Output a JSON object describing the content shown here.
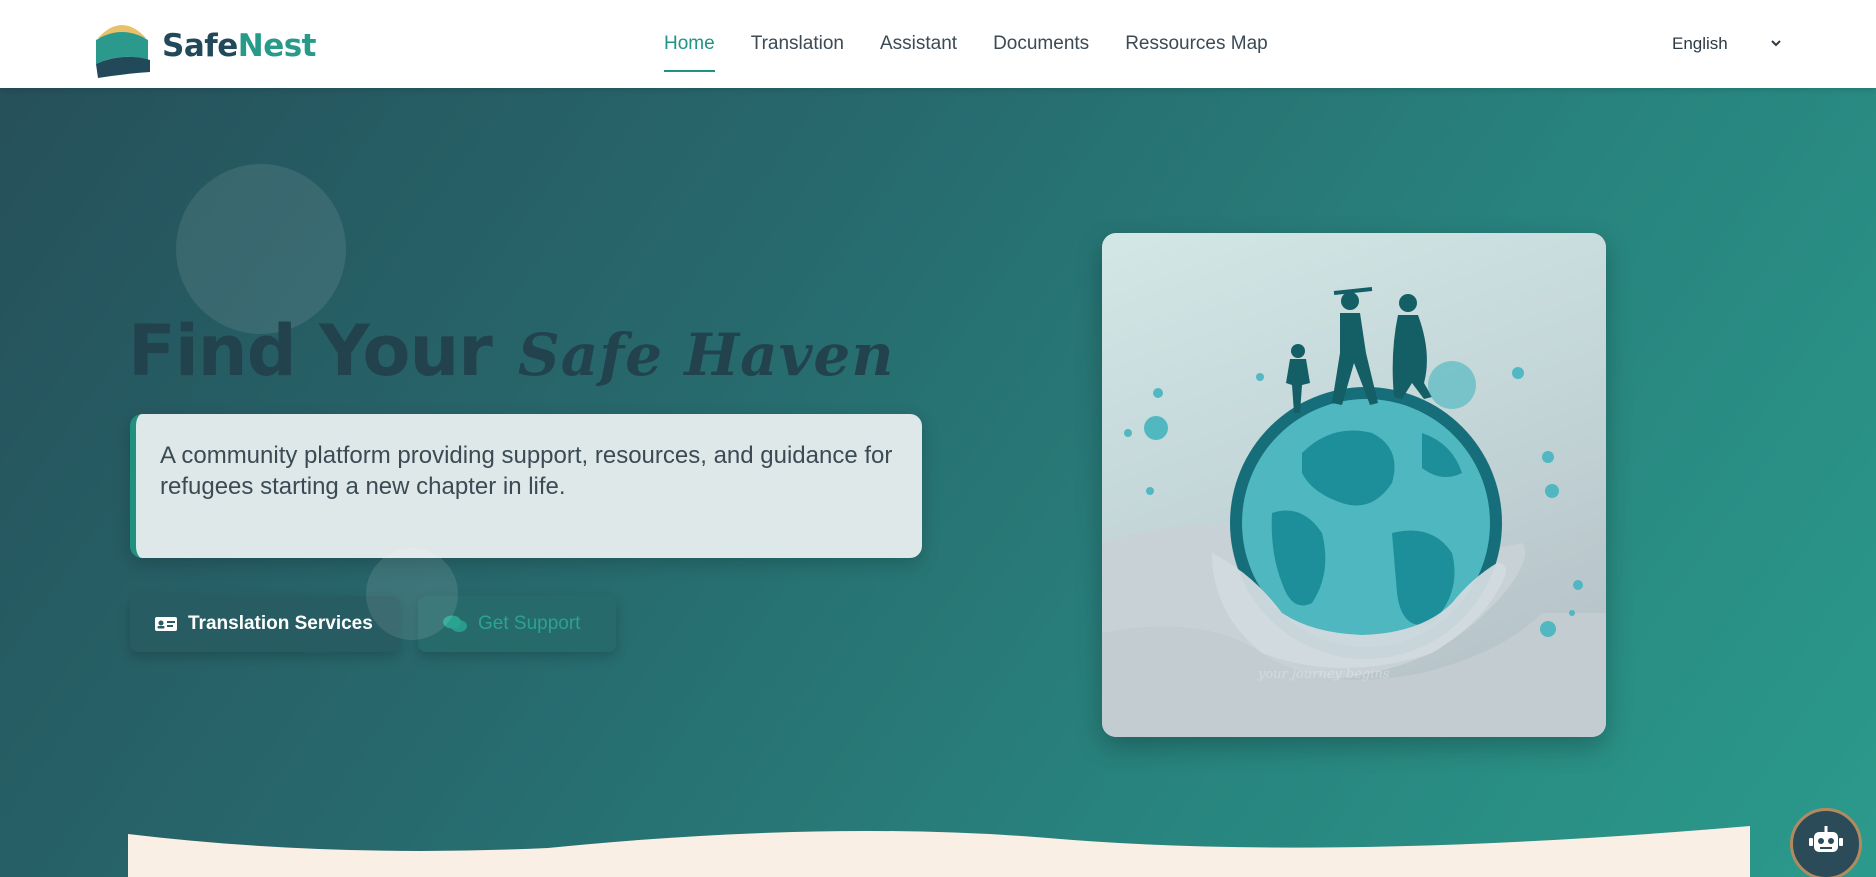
{
  "brand": {
    "name_part1": "Safe",
    "name_part2": "Nest"
  },
  "nav": {
    "items": [
      {
        "label": "Home",
        "active": true
      },
      {
        "label": "Translation",
        "active": false
      },
      {
        "label": "Assistant",
        "active": false
      },
      {
        "label": "Documents",
        "active": false
      },
      {
        "label": "Ressources Map",
        "active": false
      }
    ]
  },
  "language": {
    "selected": "English"
  },
  "hero": {
    "title_main": "Find Your",
    "title_script": "Safe Haven",
    "description": "A community platform providing support, resources, and guidance for refugees starting a new chapter in life.",
    "buttons": {
      "translation": "Translation Services",
      "support": "Get Support"
    },
    "illustration_caption": "your journey begins"
  },
  "icons": {
    "translation": "id-card-icon",
    "support": "comments-icon",
    "language_toggle": "chevron-down-icon",
    "chatbot": "robot-icon"
  },
  "colors": {
    "brand_dark": "#22495a",
    "brand_teal": "#279a8a",
    "nav_active": "#1f9485",
    "hero_start": "#26505a",
    "hero_end": "#2b9a8c",
    "cream": "#f9efe4"
  }
}
